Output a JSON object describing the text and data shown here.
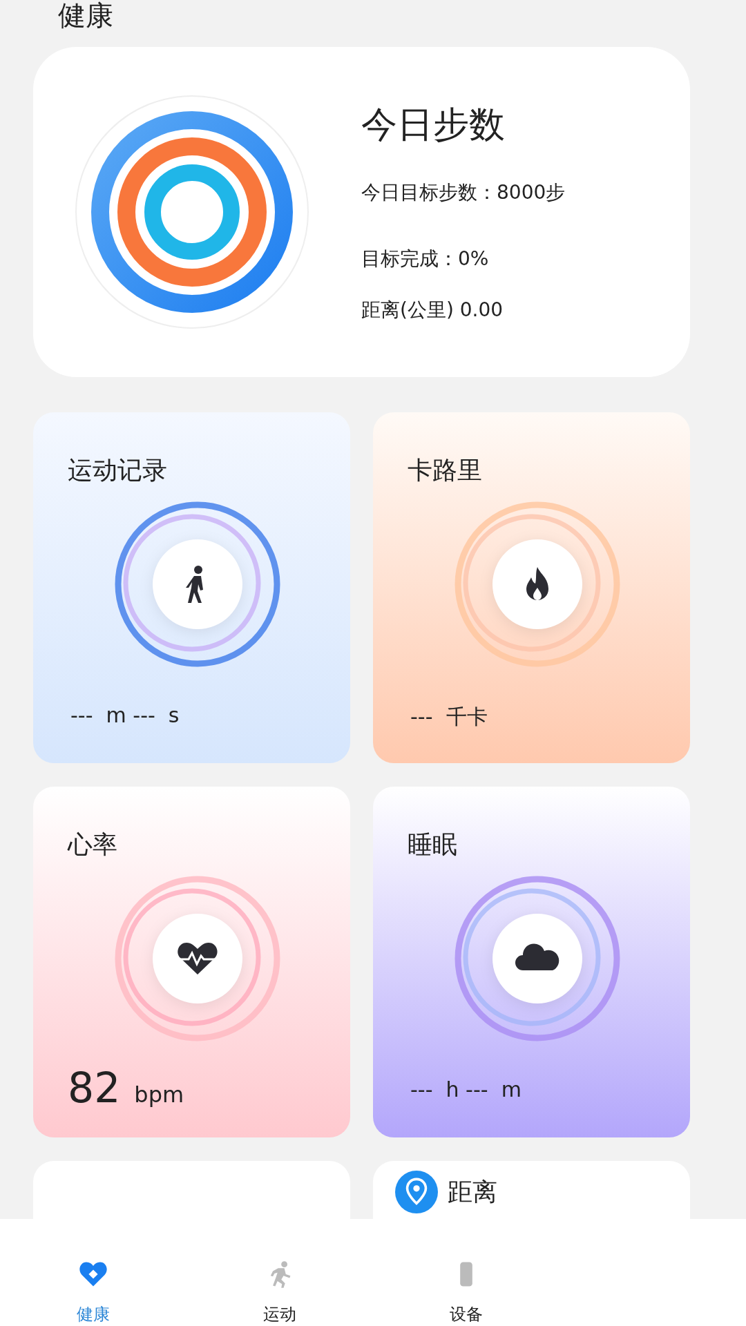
{
  "page_title": "健康",
  "steps_card": {
    "title": "今日步数",
    "goal": "今日目标步数：8000步",
    "completion": "目标完成：0%",
    "distance": "距离(公里) 0.00"
  },
  "tiles": [
    {
      "kind": "walk",
      "title": "运动记录",
      "value": "---  m ---  s"
    },
    {
      "kind": "fire",
      "title": "卡路里",
      "value": "---  千卡"
    },
    {
      "kind": "heart",
      "title": "心率",
      "value": "82",
      "unit": "bpm"
    },
    {
      "kind": "cloud",
      "title": "睡眠",
      "value": "---  h ---  m"
    },
    {
      "kind": "plain"
    },
    {
      "kind": "pin",
      "title": "距离"
    }
  ],
  "nav": [
    {
      "kind": "health",
      "label": "健康",
      "selected": true
    },
    {
      "kind": "run",
      "label": "运动",
      "selected": false
    },
    {
      "kind": "device",
      "label": "设备",
      "selected": false
    }
  ]
}
